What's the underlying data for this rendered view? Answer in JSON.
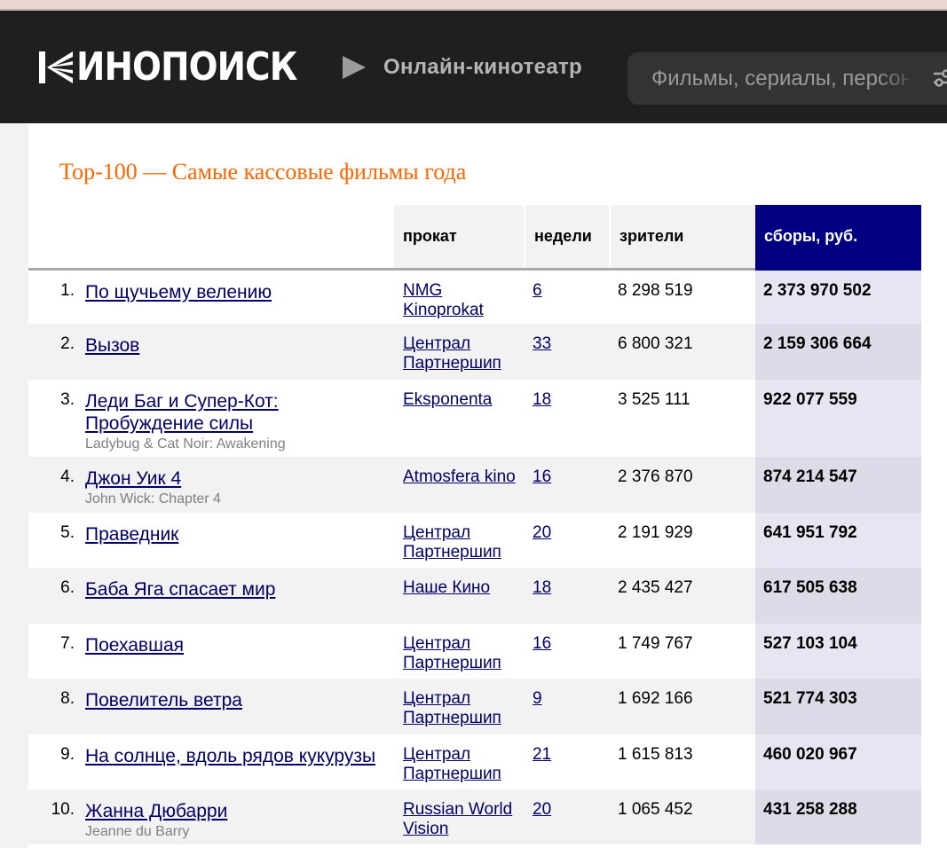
{
  "header": {
    "logo_text": "ИНОПОИСК",
    "online_label": "Онлайн-кинотеатр",
    "search_placeholder": "Фильмы, сериалы, персоны"
  },
  "page_title": "Top-100 — Самые кассовые фильмы года",
  "table": {
    "columns": {
      "distributor": "прокат",
      "weeks": "недели",
      "viewers": "зрители",
      "gross": "сборы, руб."
    },
    "rows": [
      {
        "num": "1.",
        "title": "По щучьему велению",
        "original": "",
        "dist_lines": [
          "NMG",
          "Kinoprokat"
        ],
        "weeks": "6",
        "viewers": "8 298 519",
        "gross": "2 373 970 502"
      },
      {
        "num": "2.",
        "title": "Вызов",
        "original": "",
        "dist_lines": [
          "Централ",
          "Партнершип"
        ],
        "weeks": "33",
        "viewers": "6 800 321",
        "gross": "2 159 306 664"
      },
      {
        "num": "3.",
        "title": "Леди Баг и Супер-Кот: Пробуждение силы",
        "original": "Ladybug & Cat Noir: Awakening",
        "dist_lines": [
          "Eksponenta"
        ],
        "weeks": "18",
        "viewers": "3 525 111",
        "gross": "922 077 559"
      },
      {
        "num": "4.",
        "title": "Джон Уик 4",
        "original": "John Wick: Chapter 4",
        "dist_lines": [
          "Atmosfera kino"
        ],
        "weeks": "16",
        "viewers": "2 376 870",
        "gross": "874 214 547"
      },
      {
        "num": "5.",
        "title": "Праведник",
        "original": "",
        "dist_lines": [
          "Централ",
          "Партнершип"
        ],
        "weeks": "20",
        "viewers": "2 191 929",
        "gross": "641 951 792"
      },
      {
        "num": "6.",
        "title": "Баба Яга спасает мир",
        "original": "",
        "dist_lines": [
          "Наше Кино"
        ],
        "weeks": "18",
        "viewers": "2 435 427",
        "gross": "617 505 638"
      },
      {
        "num": "7.",
        "title": "Поехавшая",
        "original": "",
        "dist_lines": [
          "Централ",
          "Партнершип"
        ],
        "weeks": "16",
        "viewers": "1 749 767",
        "gross": "527 103 104"
      },
      {
        "num": "8.",
        "title": "Повелитель ветра",
        "original": "",
        "dist_lines": [
          "Централ",
          "Партнершип"
        ],
        "weeks": "9",
        "viewers": "1 692 166",
        "gross": "521 774 303"
      },
      {
        "num": "9.",
        "title": "На солнце, вдоль рядов кукурузы",
        "original": "",
        "dist_lines": [
          "Централ",
          "Партнершип"
        ],
        "weeks": "21",
        "viewers": "1 615 813",
        "gross": "460 020 967"
      },
      {
        "num": "10.",
        "title": "Жанна Дюбарри",
        "original": "Jeanne du Barry",
        "dist_lines": [
          "Russian World",
          "Vision"
        ],
        "weeks": "20",
        "viewers": "1 065 452",
        "gross": "431 258 288"
      }
    ]
  },
  "colors": {
    "header_bg": "#1f1f1f",
    "title_accent": "#ff6600",
    "gross_header_bg": "#000080",
    "link": "#000066"
  }
}
